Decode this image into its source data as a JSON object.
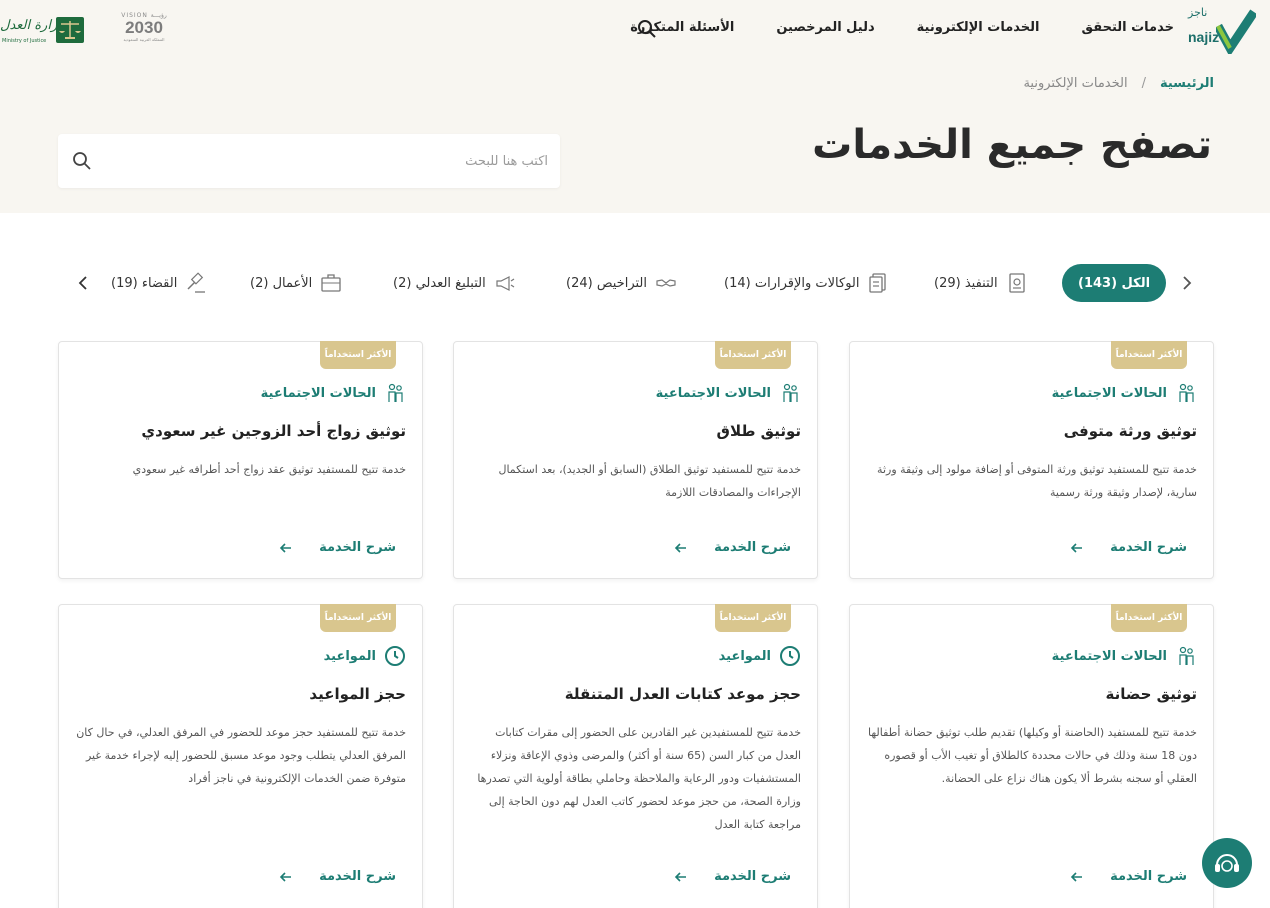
{
  "header": {
    "brand_en": "najiz",
    "brand_ar": "ناجز",
    "nav": [
      {
        "label": "خدمات التحقق"
      },
      {
        "label": "الخدمات الإلكترونية"
      },
      {
        "label": "دليل المرخصين"
      },
      {
        "label": "الأسئلة المتكررة"
      }
    ],
    "vision_top": "VISION رؤيـــة",
    "vision_year": "2030",
    "vision_sub": "المملكة العربية السعودية",
    "moj_ar": "وزارة العدل",
    "moj_en": "Ministry of Justice"
  },
  "breadcrumb": {
    "home": "الرئيسية",
    "separator": "/",
    "current": "الخدمات الإلكترونية"
  },
  "page_title": "تصفح جميع الخدمات",
  "search": {
    "placeholder": "اكتب هنا للبحث"
  },
  "tabs": [
    {
      "label": "الكل (143)",
      "icon": "none",
      "active": true
    },
    {
      "label": "التنفيذ (29)",
      "icon": "document-icon"
    },
    {
      "label": "الوكالات والإقرارات (14)",
      "icon": "papers-icon"
    },
    {
      "label": "التراخيص (24)",
      "icon": "handshake-icon"
    },
    {
      "label": "التبليغ العدلي (2)",
      "icon": "megaphone-icon"
    },
    {
      "label": "الأعمال (2)",
      "icon": "briefcase-icon"
    },
    {
      "label": "القضاء (19)",
      "icon": "gavel-icon"
    }
  ],
  "cards": [
    {
      "badge": "الأكثر استخداماً",
      "category": "الحالات الاجتماعية",
      "category_icon": "family-icon",
      "title": "توثيق ورثة متوفى",
      "desc": "خدمة تتيح للمستفيد توثيق ورثة المتوفى أو إضافة مولود إلى وثيقة ورثة سارية، لإصدار وثيقة ورثة رسمية",
      "more": "شرح الخدمة"
    },
    {
      "badge": "الأكثر استخداماً",
      "category": "الحالات الاجتماعية",
      "category_icon": "family-icon",
      "title": "توثيق طلاق",
      "desc": "خدمة تتيح للمستفيد توثيق الطلاق (السابق أو الجديد)، بعد استكمال الإجراءات والمصادقات اللازمة",
      "more": "شرح الخدمة"
    },
    {
      "badge": "الأكثر استخداماً",
      "category": "الحالات الاجتماعية",
      "category_icon": "family-icon",
      "title": "توثيق زواج أحد الزوجين غير سعودي",
      "desc": "خدمة تتيح للمستفيد توثيق عقد زواج أحد أطرافه غير سعودي",
      "more": "شرح الخدمة"
    },
    {
      "badge": "الأكثر استخداماً",
      "category": "الحالات الاجتماعية",
      "category_icon": "family-icon",
      "title": "توثيق حضانة",
      "desc": "خدمة تتيح للمستفيد (الحاضنة أو وكيلها) تقديم طلب توثيق حضانة أطفالها دون 18 سنة وذلك في حالات محددة كالطلاق أو تغيب الأب أو قصوره العقلي أو سجنه بشرط ألا يكون هناك نزاع على الحضانة.",
      "more": "شرح الخدمة"
    },
    {
      "badge": "الأكثر استخداماً",
      "category": "المواعيد",
      "category_icon": "clock-icon",
      "title": "حجز موعد كتابات العدل المتنقلة",
      "desc": "خدمة تتيح للمستفيدين غير القادرين على الحضور إلى مقرات كتابات العدل من كبار السن (65 سنة أو أكثر) والمرضى وذوي الإعاقة ونزلاء المستشفيات ودور الرعاية والملاحظة وحاملي بطاقة أولوية التي تصدرها وزارة الصحة، من حجز موعد لحضور كاتب العدل لهم دون الحاجة إلى مراجعة كتابة العدل",
      "more": "شرح الخدمة"
    },
    {
      "badge": "الأكثر استخداماً",
      "category": "المواعيد",
      "category_icon": "clock-icon",
      "title": "حجز المواعيد",
      "desc": "خدمة تتيح للمستفيد حجز موعد للحضور في المرفق العدلي، في حال كان المرفق العدلي يتطلب وجود موعد مسبق للحضور إليه لإجراء خدمة غير متوفرة ضمن الخدمات الإلكترونية في ناجز أفراد",
      "more": "شرح الخدمة"
    }
  ],
  "colors": {
    "accent": "#1d7d74",
    "badge": "#d9c68e",
    "header_bg": "#f8f6f1"
  }
}
